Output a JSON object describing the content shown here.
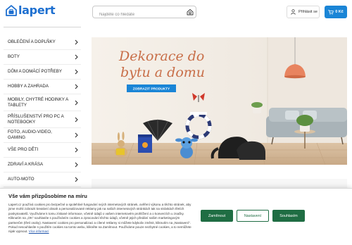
{
  "header": {
    "logo_text": "lapert",
    "search_placeholder": "Najděte co hledáte",
    "login_label": "Přihlásit se",
    "cart_label": "0 Kč"
  },
  "sidebar": {
    "items": [
      {
        "label": "OBLEČENÍ A DOPLŇKY"
      },
      {
        "label": "BOTY"
      },
      {
        "label": "DŮM A DOMÁCÍ POTŘEBY"
      },
      {
        "label": "HOBBY A ZAHRADA"
      },
      {
        "label": "MOBILY, CHYTRÉ HODINKY A TABLETY"
      },
      {
        "label": "PŘÍSLUŠENSTVÍ PRO PC A NOTEBOOKY"
      },
      {
        "label": "FOTO, AUDIO-VIDEO, GAMING"
      },
      {
        "label": "VŠE PRO DĚTI"
      },
      {
        "label": "ZDRAVÍ A KRÁSA"
      },
      {
        "label": "AUTO-MOTO"
      }
    ]
  },
  "banner": {
    "headline_line1": "Dekorace do",
    "headline_line2": "bytu a domu",
    "cta_label": "ZOBRAZIT PRODUKTY",
    "accent_color": "#c86e48",
    "cta_color": "#1a85d6"
  },
  "cookie": {
    "title": "Vše vám přizpůsobíme na míru",
    "text": "Lapert.cz používá cookies pro bezpečné a spolehlivé fungování svých internetových stránek, ověření výkonu a těchto stránek, aby jsme mohli zobrazit kreativní obsah a personalizované reklamy jak na našich internetových stránkách tak na stránkách třetích poskytovatelů. Využíváme k tomu získané informace, včetně údajů o vašem internetovém prohlížení a o konverzích u značky. Kliknutím na „OK“ souhlasíte s používáním cookies a zpracování těchto údajů, včetně jejich předání našim marketingovým partnerům (třetí osoby). Nastavení cookies pro personalizaci a cílené reklamy si můžete kdykoliv změnit, kliknutím na „Nastavení“. Pokud nesouhlasíte s použitím cookies na tomto webu, klikněte na Zamítnout. Používáme pouze nezbytné cookies, a to nemůžete nijak vypnout.",
    "link_label": "Více informací",
    "reject_label": "Zamítnout",
    "settings_label": "Nastavení",
    "accept_label": "Souhlasím"
  }
}
